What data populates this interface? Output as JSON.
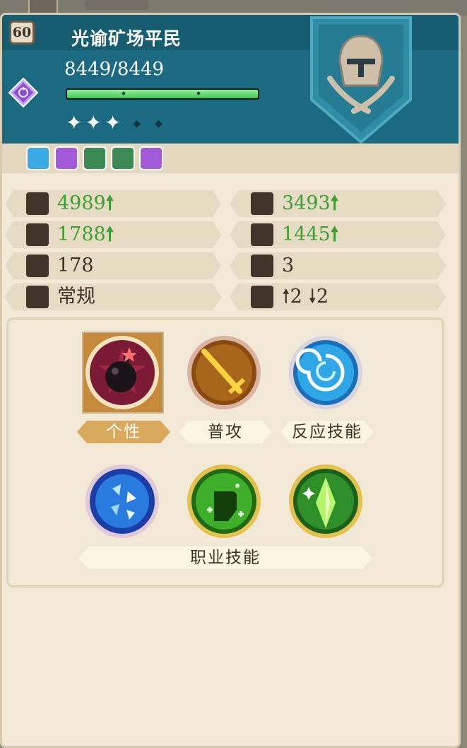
{
  "character": {
    "level": "60",
    "name": "光谕矿场平民",
    "hp": "8449/8449",
    "hp_fraction": 1.0,
    "stars_filled": "✦✦✦",
    "stars_empty": "◆◆"
  },
  "stats": [
    {
      "icon": "sword-icon",
      "value": "4989",
      "arrow": "🠕",
      "color": "green"
    },
    {
      "icon": "staff-icon",
      "value": "3493",
      "arrow": "🠕",
      "color": "green"
    },
    {
      "icon": "shield-icon",
      "value": "1788",
      "arrow": "🠕",
      "color": "green"
    },
    {
      "icon": "wizard-hat-icon",
      "value": "1445",
      "arrow": "🠕",
      "color": "green"
    },
    {
      "icon": "wing-icon",
      "value": "178",
      "arrow": "",
      "color": "dark"
    },
    {
      "icon": "boot-icon",
      "value": "3",
      "arrow": "",
      "color": "dark"
    },
    {
      "icon": "figure-icon",
      "value": "常规",
      "arrow": "",
      "color": "dark"
    },
    {
      "icon": "elevation-icon",
      "value": "🠕2 🠗2",
      "arrow": "",
      "color": "dark"
    }
  ],
  "skills": {
    "tabs": [
      "个性",
      "普攻",
      "反应技能"
    ],
    "active_tab": "个性",
    "class_skill_label": "职业技能"
  },
  "colors": {
    "header": "#1b6a81",
    "panel": "#f1e9d6",
    "stat_up": "#3f9f33"
  }
}
